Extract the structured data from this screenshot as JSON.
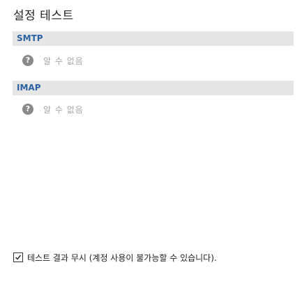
{
  "title": "설정 테스트",
  "sections": [
    {
      "label": "SMTP",
      "status_icon": "help-icon",
      "status_text": "알 수 없음"
    },
    {
      "label": "IMAP",
      "status_icon": "help-icon",
      "status_text": "알 수 없음"
    }
  ],
  "status_icon_glyph": "?",
  "ignore_results": {
    "label": "테스트 결과 무시 (계정 사용이 불가능할 수 있습니다).",
    "checked": true
  },
  "colors": {
    "section_header_bg": "#e6e6e6",
    "section_header_text": "#2b62a3",
    "status_icon_bg": "#8a8a8a",
    "status_text": "#a6a6a6"
  }
}
